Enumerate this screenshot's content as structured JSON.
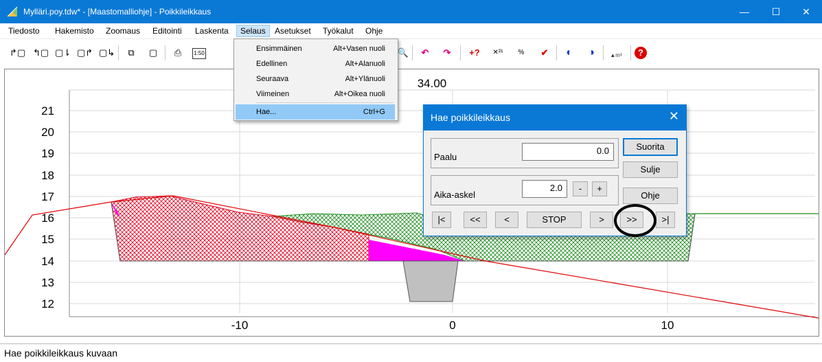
{
  "window": {
    "title": "Mylläri.poy.tdw* - [Maastomalliohje] - Poikkileikkaus",
    "controls": [
      "—",
      "☐",
      "✕"
    ]
  },
  "menubar": {
    "items": [
      "Tiedosto",
      "Hakemisto",
      "Zoomaus",
      "Editointi",
      "Laskenta",
      "Selaus",
      "Asetukset",
      "Työkalut",
      "Ohje"
    ],
    "active": "Selaus"
  },
  "selaus_menu": {
    "items": [
      {
        "label": "Ensimmäinen",
        "shortcut": "Alt+Vasen nuoli"
      },
      {
        "label": "Edellinen",
        "shortcut": "Alt+Alanuoli"
      },
      {
        "label": "Seuraava",
        "shortcut": "Alt+Ylänuoli"
      },
      {
        "label": "Viimeinen",
        "shortcut": "Alt+Oikea nuoli"
      },
      {
        "label": "Hae...",
        "shortcut": "Ctrl+G"
      }
    ],
    "highlighted": "Hae..."
  },
  "toolbar": {
    "scale_label": "1:50",
    "m3_label": "m³"
  },
  "plot": {
    "station_title": "34.00",
    "y_ticks": [
      "21",
      "20",
      "19",
      "18",
      "17",
      "16",
      "15",
      "14",
      "13",
      "12"
    ],
    "x_ticks": [
      "-10",
      "0",
      "10"
    ],
    "colors": {
      "ground": "#e00000",
      "cut_fill": "#e0001e",
      "fill_green": "#1e8c1e",
      "magenta": "#ff00ff",
      "structure_gray": "#c0c0c0"
    }
  },
  "dialog": {
    "title": "Hae poikkileikkaus",
    "paalu_label": "Paalu",
    "paalu_value": "0.0",
    "aika_label": "Aika-askel",
    "aika_value": "2.0",
    "minus": "-",
    "plus": "+",
    "suorita": "Suorita",
    "sulje": "Sulje",
    "ohje": "Ohje",
    "nav": [
      "|<",
      "<<",
      "<",
      "STOP",
      ">",
      ">>",
      ">|"
    ]
  },
  "status": "Hae poikkileikkaus kuvaan"
}
